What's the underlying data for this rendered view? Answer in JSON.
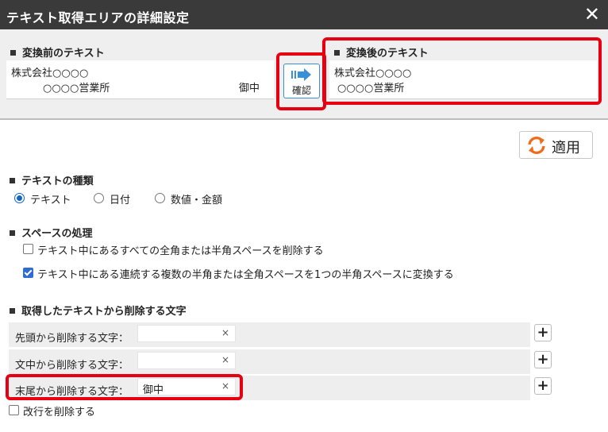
{
  "window": {
    "title": "テキスト取得エリアの詳細設定",
    "close_label": "✕"
  },
  "before": {
    "heading": "変換前のテキスト",
    "line1": "株式会社○○○○",
    "line2": "○○○○営業所",
    "line2_suffix": "御中"
  },
  "confirm": {
    "label": "確認"
  },
  "after": {
    "heading": "変換後のテキスト",
    "line1": "株式会社○○○○",
    "line2": "○○○○営業所"
  },
  "apply": {
    "label": "適用"
  },
  "text_type": {
    "heading": "テキストの種類",
    "options": [
      {
        "label": "テキスト",
        "selected": true
      },
      {
        "label": "日付",
        "selected": false
      },
      {
        "label": "数値・金額",
        "selected": false
      }
    ]
  },
  "space": {
    "heading": "スペースの処理",
    "options": [
      {
        "label": "テキスト中にあるすべての全角または半角スペースを削除する",
        "checked": false
      },
      {
        "label": "テキスト中にある連続する複数の半角または全角スペースを1つの半角スペースに変換する",
        "checked": true
      }
    ]
  },
  "remove_chars": {
    "heading": "取得したテキストから削除する文字",
    "rows": [
      {
        "label": "先頭から削除する文字：",
        "value": ""
      },
      {
        "label": "文中から削除する文字：",
        "value": ""
      },
      {
        "label": "末尾から削除する文字：",
        "value": "御中"
      }
    ],
    "clear_glyph": "×",
    "add_glyph": "+"
  },
  "newline": {
    "label": "改行を削除する",
    "checked": false
  },
  "colors": {
    "accent": "#1565c0",
    "highlight": "#e60012",
    "titlebar": "#3a3a3a"
  }
}
